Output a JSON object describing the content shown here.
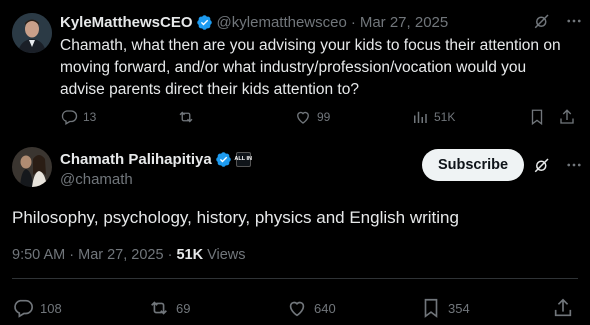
{
  "reply": {
    "author_name": "KyleMatthewsCEO",
    "handle": "@kylematthewsceo",
    "separator": "·",
    "date": "Mar 27, 2025",
    "text": "Chamath, what then are you advising your kids to focus their attention on moving forward, and/or what industry/profession/vocation would you advise parents direct their kids attention to?",
    "replies": "13",
    "reposts": "",
    "likes": "99",
    "views": "51K"
  },
  "tweet": {
    "author_name": "Chamath Palihapitiya",
    "affiliate_badge_text": "ALL IN",
    "handle": "@chamath",
    "subscribe_label": "Subscribe",
    "text": "Philosophy, psychology, history, physics and English writing",
    "time": "9:50 AM",
    "separator": "·",
    "date": "Mar 27, 2025",
    "view_count": "51K",
    "views_label": "Views",
    "replies": "108",
    "reposts": "69",
    "likes": "640",
    "bookmarks": "354"
  },
  "colors": {
    "background": "#000000",
    "text_primary": "#e7e9ea",
    "text_secondary": "#71767b",
    "verified_blue": "#1d9bf0",
    "divider": "#2f3336",
    "subscribe_bg": "#eff3f4"
  }
}
